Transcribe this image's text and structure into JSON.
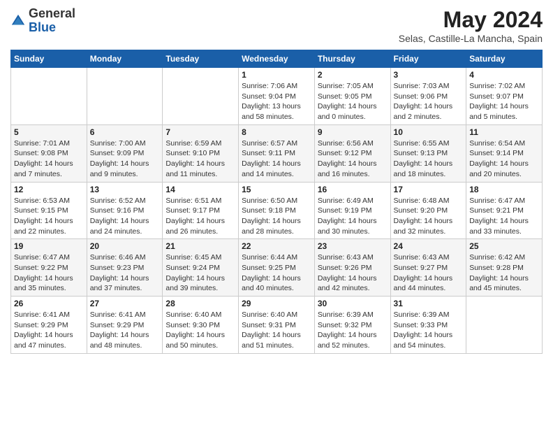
{
  "header": {
    "logo_general": "General",
    "logo_blue": "Blue",
    "month_year": "May 2024",
    "location": "Selas, Castille-La Mancha, Spain"
  },
  "weekdays": [
    "Sunday",
    "Monday",
    "Tuesday",
    "Wednesday",
    "Thursday",
    "Friday",
    "Saturday"
  ],
  "weeks": [
    [
      {
        "day": "",
        "detail": ""
      },
      {
        "day": "",
        "detail": ""
      },
      {
        "day": "",
        "detail": ""
      },
      {
        "day": "1",
        "detail": "Sunrise: 7:06 AM\nSunset: 9:04 PM\nDaylight: 13 hours\nand 58 minutes."
      },
      {
        "day": "2",
        "detail": "Sunrise: 7:05 AM\nSunset: 9:05 PM\nDaylight: 14 hours\nand 0 minutes."
      },
      {
        "day": "3",
        "detail": "Sunrise: 7:03 AM\nSunset: 9:06 PM\nDaylight: 14 hours\nand 2 minutes."
      },
      {
        "day": "4",
        "detail": "Sunrise: 7:02 AM\nSunset: 9:07 PM\nDaylight: 14 hours\nand 5 minutes."
      }
    ],
    [
      {
        "day": "5",
        "detail": "Sunrise: 7:01 AM\nSunset: 9:08 PM\nDaylight: 14 hours\nand 7 minutes."
      },
      {
        "day": "6",
        "detail": "Sunrise: 7:00 AM\nSunset: 9:09 PM\nDaylight: 14 hours\nand 9 minutes."
      },
      {
        "day": "7",
        "detail": "Sunrise: 6:59 AM\nSunset: 9:10 PM\nDaylight: 14 hours\nand 11 minutes."
      },
      {
        "day": "8",
        "detail": "Sunrise: 6:57 AM\nSunset: 9:11 PM\nDaylight: 14 hours\nand 14 minutes."
      },
      {
        "day": "9",
        "detail": "Sunrise: 6:56 AM\nSunset: 9:12 PM\nDaylight: 14 hours\nand 16 minutes."
      },
      {
        "day": "10",
        "detail": "Sunrise: 6:55 AM\nSunset: 9:13 PM\nDaylight: 14 hours\nand 18 minutes."
      },
      {
        "day": "11",
        "detail": "Sunrise: 6:54 AM\nSunset: 9:14 PM\nDaylight: 14 hours\nand 20 minutes."
      }
    ],
    [
      {
        "day": "12",
        "detail": "Sunrise: 6:53 AM\nSunset: 9:15 PM\nDaylight: 14 hours\nand 22 minutes."
      },
      {
        "day": "13",
        "detail": "Sunrise: 6:52 AM\nSunset: 9:16 PM\nDaylight: 14 hours\nand 24 minutes."
      },
      {
        "day": "14",
        "detail": "Sunrise: 6:51 AM\nSunset: 9:17 PM\nDaylight: 14 hours\nand 26 minutes."
      },
      {
        "day": "15",
        "detail": "Sunrise: 6:50 AM\nSunset: 9:18 PM\nDaylight: 14 hours\nand 28 minutes."
      },
      {
        "day": "16",
        "detail": "Sunrise: 6:49 AM\nSunset: 9:19 PM\nDaylight: 14 hours\nand 30 minutes."
      },
      {
        "day": "17",
        "detail": "Sunrise: 6:48 AM\nSunset: 9:20 PM\nDaylight: 14 hours\nand 32 minutes."
      },
      {
        "day": "18",
        "detail": "Sunrise: 6:47 AM\nSunset: 9:21 PM\nDaylight: 14 hours\nand 33 minutes."
      }
    ],
    [
      {
        "day": "19",
        "detail": "Sunrise: 6:47 AM\nSunset: 9:22 PM\nDaylight: 14 hours\nand 35 minutes."
      },
      {
        "day": "20",
        "detail": "Sunrise: 6:46 AM\nSunset: 9:23 PM\nDaylight: 14 hours\nand 37 minutes."
      },
      {
        "day": "21",
        "detail": "Sunrise: 6:45 AM\nSunset: 9:24 PM\nDaylight: 14 hours\nand 39 minutes."
      },
      {
        "day": "22",
        "detail": "Sunrise: 6:44 AM\nSunset: 9:25 PM\nDaylight: 14 hours\nand 40 minutes."
      },
      {
        "day": "23",
        "detail": "Sunrise: 6:43 AM\nSunset: 9:26 PM\nDaylight: 14 hours\nand 42 minutes."
      },
      {
        "day": "24",
        "detail": "Sunrise: 6:43 AM\nSunset: 9:27 PM\nDaylight: 14 hours\nand 44 minutes."
      },
      {
        "day": "25",
        "detail": "Sunrise: 6:42 AM\nSunset: 9:28 PM\nDaylight: 14 hours\nand 45 minutes."
      }
    ],
    [
      {
        "day": "26",
        "detail": "Sunrise: 6:41 AM\nSunset: 9:29 PM\nDaylight: 14 hours\nand 47 minutes."
      },
      {
        "day": "27",
        "detail": "Sunrise: 6:41 AM\nSunset: 9:29 PM\nDaylight: 14 hours\nand 48 minutes."
      },
      {
        "day": "28",
        "detail": "Sunrise: 6:40 AM\nSunset: 9:30 PM\nDaylight: 14 hours\nand 50 minutes."
      },
      {
        "day": "29",
        "detail": "Sunrise: 6:40 AM\nSunset: 9:31 PM\nDaylight: 14 hours\nand 51 minutes."
      },
      {
        "day": "30",
        "detail": "Sunrise: 6:39 AM\nSunset: 9:32 PM\nDaylight: 14 hours\nand 52 minutes."
      },
      {
        "day": "31",
        "detail": "Sunrise: 6:39 AM\nSunset: 9:33 PM\nDaylight: 14 hours\nand 54 minutes."
      },
      {
        "day": "",
        "detail": ""
      }
    ]
  ]
}
